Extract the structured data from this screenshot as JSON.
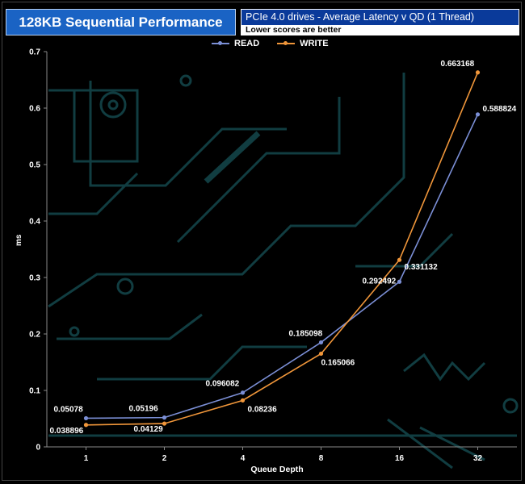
{
  "header": {
    "title": "128KB Sequential Performance",
    "subtitle": "PCIe 4.0 drives - Average Latency v QD (1 Thread)",
    "note": "Lower scores are better"
  },
  "colors": {
    "read": "#7b8fd6",
    "write": "#f0963a",
    "title_bg": "#1a63c4",
    "subtitle_bg": "#0a3a9a",
    "circuit": "#1f6f77"
  },
  "chart_data": {
    "type": "line",
    "title": "128KB Sequential Performance",
    "subtitle": "PCIe 4.0 drives - Average Latency v QD (1 Thread)",
    "xlabel": "Queue Depth",
    "ylabel": "ms",
    "categories": [
      "1",
      "2",
      "4",
      "8",
      "16",
      "32"
    ],
    "ylim": [
      0,
      0.7
    ],
    "yticks": [
      "0",
      "0.1",
      "0.2",
      "0.3",
      "0.4",
      "0.5",
      "0.6",
      "0.7"
    ],
    "legend_position": "top-center",
    "grid": false,
    "series": [
      {
        "name": "READ",
        "values": [
          0.05078,
          0.05196,
          0.096082,
          0.185098,
          0.292492,
          0.588824
        ],
        "labels": [
          "0.05078",
          "0.05196",
          "0.096082",
          "0.185098",
          "0.292492",
          "0.588824"
        ]
      },
      {
        "name": "WRITE",
        "values": [
          0.038896,
          0.04129,
          0.08236,
          0.165066,
          0.331132,
          0.663168
        ],
        "labels": [
          "0.038896",
          "0.04129",
          "0.08236",
          "0.165066",
          "0.331132",
          "0.663168"
        ]
      }
    ]
  }
}
